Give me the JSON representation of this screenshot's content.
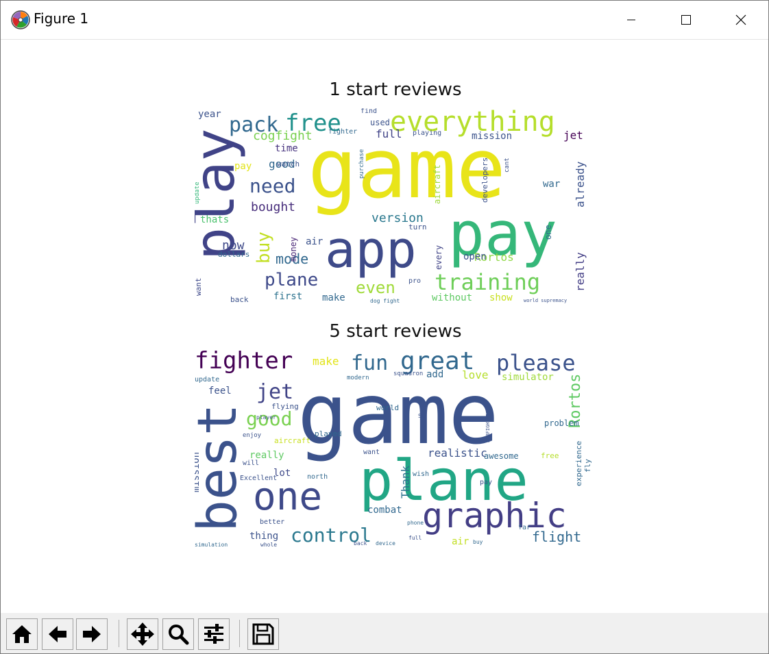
{
  "window": {
    "title": "Figure 1",
    "icon": "matplotlib-logo-icon",
    "controls": [
      "minimize-icon",
      "maximize-icon",
      "close-icon"
    ]
  },
  "toolbar": {
    "buttons": [
      {
        "name": "home-button",
        "icon": "home-icon"
      },
      {
        "name": "back-button",
        "icon": "arrow-left-icon"
      },
      {
        "name": "forward-button",
        "icon": "arrow-right-icon"
      },
      {
        "name": "pan-button",
        "icon": "move-icon"
      },
      {
        "name": "zoom-button",
        "icon": "magnifier-icon"
      },
      {
        "name": "configure-subplots-button",
        "icon": "sliders-icon"
      },
      {
        "name": "save-button",
        "icon": "floppy-disk-icon"
      }
    ]
  },
  "figure": {
    "panels": [
      {
        "title": "1 start reviews",
        "words": [
          {
            "text": "game",
            "color": "#e8e419",
            "size": 120,
            "rotate": 0
          },
          {
            "text": "play",
            "color": "#404387",
            "size": 80,
            "rotate": -90
          },
          {
            "text": "pay",
            "color": "#35b779",
            "size": 88,
            "rotate": 0
          },
          {
            "text": "app",
            "color": "#3e4a89",
            "size": 74,
            "rotate": 0
          },
          {
            "text": "everything",
            "color": "#b5de2b",
            "size": 40,
            "rotate": 0
          },
          {
            "text": "free",
            "color": "#21918c",
            "size": 34,
            "rotate": 0
          },
          {
            "text": "pack",
            "color": "#31688e",
            "size": 30,
            "rotate": 0
          },
          {
            "text": "training",
            "color": "#6ece58",
            "size": 32,
            "rotate": 0
          },
          {
            "text": "need",
            "color": "#3b528b",
            "size": 28,
            "rotate": 0
          },
          {
            "text": "cogfight",
            "color": "#7ad151",
            "size": 18,
            "rotate": 0
          },
          {
            "text": "buy",
            "color": "#c2df23",
            "size": 26,
            "rotate": -90
          },
          {
            "text": "plane",
            "color": "#3e4989",
            "size": 26,
            "rotate": 0
          },
          {
            "text": "even",
            "color": "#a0da39",
            "size": 24,
            "rotate": 0
          },
          {
            "text": "mode",
            "color": "#31688e",
            "size": 20,
            "rotate": 0
          },
          {
            "text": "version",
            "color": "#2a788e",
            "size": 18,
            "rotate": 0
          },
          {
            "text": "mission",
            "color": "#3b528b",
            "size": 14,
            "rotate": 0
          },
          {
            "text": "bought",
            "color": "#472d7b",
            "size": 18,
            "rotate": 0
          },
          {
            "text": "now",
            "color": "#3e4989",
            "size": 18,
            "rotate": 0
          },
          {
            "text": "good",
            "color": "#31688e",
            "size": 16,
            "rotate": 0
          },
          {
            "text": "full",
            "color": "#404387",
            "size": 16,
            "rotate": 0
          },
          {
            "text": "Rortos",
            "color": "#8fd744",
            "size": 16,
            "rotate": 0
          },
          {
            "text": "already",
            "color": "#3b528b",
            "size": 16,
            "rotate": -90
          },
          {
            "text": "really",
            "color": "#433e85",
            "size": 16,
            "rotate": -90
          },
          {
            "text": "without",
            "color": "#5ec962",
            "size": 14,
            "rotate": 0
          },
          {
            "text": "show",
            "color": "#c8e020",
            "size": 14,
            "rotate": 0
          },
          {
            "text": "first",
            "color": "#2c728e",
            "size": 14,
            "rotate": 0
          },
          {
            "text": "make",
            "color": "#31688e",
            "size": 14,
            "rotate": 0
          },
          {
            "text": "year",
            "color": "#3b528b",
            "size": 14,
            "rotate": 0
          },
          {
            "text": "time",
            "color": "#46327e",
            "size": 14,
            "rotate": 0
          },
          {
            "text": "war",
            "color": "#31688e",
            "size": 14,
            "rotate": 0
          },
          {
            "text": "thats",
            "color": "#4ac16d",
            "size": 14,
            "rotate": 0
          },
          {
            "text": "open",
            "color": "#3b528b",
            "size": 14,
            "rotate": 0
          },
          {
            "text": "air",
            "color": "#3b528b",
            "size": 14,
            "rotate": 0
          },
          {
            "text": "money",
            "color": "#482475",
            "size": 12,
            "rotate": -90
          },
          {
            "text": "aircraft",
            "color": "#9dd93b",
            "size": 12,
            "rotate": -90
          },
          {
            "text": "developers",
            "color": "#3b528b",
            "size": 11,
            "rotate": -90
          },
          {
            "text": "every",
            "color": "#414487",
            "size": 12,
            "rotate": -90
          },
          {
            "text": "dollars",
            "color": "#31688e",
            "size": 11,
            "rotate": 0
          },
          {
            "text": "back",
            "color": "#3b528b",
            "size": 11,
            "rotate": 0
          },
          {
            "text": "want",
            "color": "#3e4989",
            "size": 11,
            "rotate": -90
          },
          {
            "text": "one",
            "color": "#31688e",
            "size": 12,
            "rotate": -90
          },
          {
            "text": "used",
            "color": "#3b528b",
            "size": 12,
            "rotate": 0
          },
          {
            "text": "jet",
            "color": "#440154",
            "size": 16,
            "rotate": 0
          },
          {
            "text": "pay",
            "color": "#e2e418",
            "size": 14,
            "rotate": 0
          },
          {
            "text": "turn",
            "color": "#3b528b",
            "size": 11,
            "rotate": 0
          },
          {
            "text": "find",
            "color": "#3b528b",
            "size": 10,
            "rotate": 0
          },
          {
            "text": "fighter",
            "color": "#31688e",
            "size": 10,
            "rotate": 0
          },
          {
            "text": "playing",
            "color": "#3b528b",
            "size": 10,
            "rotate": 0
          },
          {
            "text": "watch",
            "color": "#3b528b",
            "size": 11,
            "rotate": 0
          },
          {
            "text": "dog fight",
            "color": "#31688e",
            "size": 8,
            "rotate": 0
          },
          {
            "text": "world supremacy",
            "color": "#3b528b",
            "size": 7,
            "rotate": 0
          },
          {
            "text": "cant",
            "color": "#3b528b",
            "size": 9,
            "rotate": -90
          },
          {
            "text": "purchase",
            "color": "#31688e",
            "size": 9,
            "rotate": -90
          },
          {
            "text": "pro",
            "color": "#3b528b",
            "size": 10,
            "rotate": 0
          },
          {
            "text": "update",
            "color": "#35b779",
            "size": 9,
            "rotate": -90
          }
        ]
      },
      {
        "title": "5 start reviews",
        "words": [
          {
            "text": "game",
            "color": "#3b528b",
            "size": 122,
            "rotate": 0
          },
          {
            "text": "plane",
            "color": "#21a685",
            "size": 82,
            "rotate": 0
          },
          {
            "text": "best",
            "color": "#3b528b",
            "size": 78,
            "rotate": -90
          },
          {
            "text": "one",
            "color": "#3e4989",
            "size": 56,
            "rotate": 0
          },
          {
            "text": "graphic",
            "color": "#433e85",
            "size": 50,
            "rotate": 0
          },
          {
            "text": "great",
            "color": "#31688e",
            "size": 36,
            "rotate": 0
          },
          {
            "text": "fighter",
            "color": "#440154",
            "size": 34,
            "rotate": 0
          },
          {
            "text": "please",
            "color": "#3b528b",
            "size": 32,
            "rotate": 0
          },
          {
            "text": "fun",
            "color": "#31688e",
            "size": 30,
            "rotate": 0
          },
          {
            "text": "jet",
            "color": "#414487",
            "size": 30,
            "rotate": 0
          },
          {
            "text": "control",
            "color": "#2a788e",
            "size": 28,
            "rotate": 0
          },
          {
            "text": "good",
            "color": "#7ad151",
            "size": 28,
            "rotate": 0
          },
          {
            "text": "Rortos",
            "color": "#5ec962",
            "size": 22,
            "rotate": -90
          },
          {
            "text": "flight",
            "color": "#31688e",
            "size": 20,
            "rotate": 0
          },
          {
            "text": "simulator",
            "color": "#a0da39",
            "size": 14,
            "rotate": 0
          },
          {
            "text": "love",
            "color": "#b5de2b",
            "size": 16,
            "rotate": 0
          },
          {
            "text": "make",
            "color": "#e2e418",
            "size": 16,
            "rotate": 0
          },
          {
            "text": "realistic",
            "color": "#3b528b",
            "size": 16,
            "rotate": 0
          },
          {
            "text": "Thank",
            "color": "#2c728e",
            "size": 16,
            "rotate": -90
          },
          {
            "text": "awesome",
            "color": "#31688e",
            "size": 12,
            "rotate": 0
          },
          {
            "text": "mission",
            "color": "#3b528b",
            "size": 14,
            "rotate": -90
          },
          {
            "text": "combat",
            "color": "#31688e",
            "size": 14,
            "rotate": 0
          },
          {
            "text": "really",
            "color": "#5ec962",
            "size": 14,
            "rotate": 0
          },
          {
            "text": "problem",
            "color": "#31688e",
            "size": 12,
            "rotate": 0
          },
          {
            "text": "experience",
            "color": "#31688e",
            "size": 11,
            "rotate": -90
          },
          {
            "text": "thing",
            "color": "#3b528b",
            "size": 14,
            "rotate": 0
          },
          {
            "text": "air",
            "color": "#c2df23",
            "size": 14,
            "rotate": 0
          },
          {
            "text": "feel",
            "color": "#3b528b",
            "size": 14,
            "rotate": 0
          },
          {
            "text": "add",
            "color": "#31688e",
            "size": 14,
            "rotate": 0
          },
          {
            "text": "lot",
            "color": "#3e4989",
            "size": 14,
            "rotate": 0
          },
          {
            "text": "played",
            "color": "#31688e",
            "size": 11,
            "rotate": 0
          },
          {
            "text": "aircraft",
            "color": "#c8e020",
            "size": 11,
            "rotate": 0
          },
          {
            "text": "flying",
            "color": "#3b528b",
            "size": 11,
            "rotate": 0
          },
          {
            "text": "world",
            "color": "#31688e",
            "size": 11,
            "rotate": 0
          },
          {
            "text": "free",
            "color": "#b5de2b",
            "size": 11,
            "rotate": 0
          },
          {
            "text": "fly",
            "color": "#31688e",
            "size": 11,
            "rotate": -90
          },
          {
            "text": "Excellent",
            "color": "#3b528b",
            "size": 10,
            "rotate": 0
          },
          {
            "text": "better",
            "color": "#3b528b",
            "size": 10,
            "rotate": 0
          },
          {
            "text": "wish",
            "color": "#31688e",
            "size": 10,
            "rotate": 0
          },
          {
            "text": "far",
            "color": "#31688e",
            "size": 10,
            "rotate": 0
          },
          {
            "text": "pay",
            "color": "#3b528b",
            "size": 10,
            "rotate": 0
          },
          {
            "text": "update",
            "color": "#31688e",
            "size": 10,
            "rotate": 0
          },
          {
            "text": "want",
            "color": "#3b528b",
            "size": 10,
            "rotate": 0
          },
          {
            "text": "north",
            "color": "#31688e",
            "size": 10,
            "rotate": 0
          },
          {
            "text": "will",
            "color": "#3b528b",
            "size": 10,
            "rotate": 0
          },
          {
            "text": "enjoy",
            "color": "#3b528b",
            "size": 9,
            "rotate": 0
          },
          {
            "text": "squadron",
            "color": "#3b528b",
            "size": 9,
            "rotate": 0
          },
          {
            "text": "modern",
            "color": "#31688e",
            "size": 9,
            "rotate": 0
          },
          {
            "text": "player",
            "color": "#3b528b",
            "size": 8,
            "rotate": 0
          },
          {
            "text": "phone",
            "color": "#31688e",
            "size": 8,
            "rotate": 0
          },
          {
            "text": "full",
            "color": "#3b528b",
            "size": 8,
            "rotate": 0
          },
          {
            "text": "device",
            "color": "#31688e",
            "size": 8,
            "rotate": 0
          },
          {
            "text": "back",
            "color": "#3b528b",
            "size": 8,
            "rotate": 0
          },
          {
            "text": "simulation",
            "color": "#31688e",
            "size": 8,
            "rotate": 0
          },
          {
            "text": "whole",
            "color": "#3b528b",
            "size": 8,
            "rotate": 0
          },
          {
            "text": "AIRFIGHTERS",
            "color": "#3b528b",
            "size": 7,
            "rotate": -90
          },
          {
            "text": "buy",
            "color": "#31688e",
            "size": 8,
            "rotate": 0
          },
          {
            "text": "SR",
            "color": "#3b528b",
            "size": 8,
            "rotate": 0
          }
        ]
      }
    ]
  }
}
